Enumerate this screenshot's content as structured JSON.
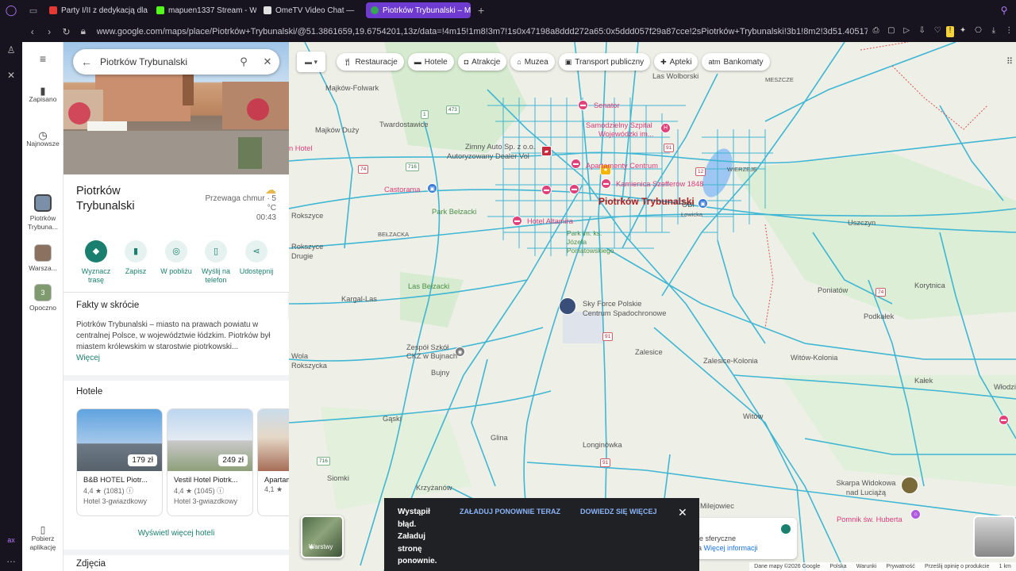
{
  "browser": {
    "tabs": [
      {
        "title": "Party I/II z dedykacją dla K",
        "color": "#e53935"
      },
      {
        "title": "mapuen1337 Stream - Wa",
        "color": "#53fc18"
      },
      {
        "title": "OmeTV Video Chat —",
        "color": "#e0e0e0"
      },
      {
        "title": "Piotrków Trybunalski – Ma",
        "color": "#34a853"
      }
    ],
    "url": "www.google.com/maps/place/Piotrków+Trybunalski/@51.3861659,19.6754201,13z/data=!4m15!1m8!3m7!1s0x47198a8ddd272a65:0x5ddd057f29a87cce!2sPiotrków+Trybunalski!3b1!8m2!3d51.4051721!4d19.7030244!16zL20vMDIyOH"
  },
  "rail": {
    "saved": "Zapisano",
    "recent": "Najnowsze",
    "place1": "Piotrków Trybuna...",
    "place2": "Warsza...",
    "place3": "Opoczno",
    "place3_badge": "3",
    "get_app": "Pobierz aplikację"
  },
  "panel": {
    "search_value": "Piotrków Trybunalski",
    "title": "Piotrków Trybunalski",
    "weather_desc": "Przewaga chmur · 5 °C",
    "time": "00:43",
    "actions": {
      "route": "Wyznacz trasę",
      "save": "Zapisz",
      "nearby": "W pobliżu",
      "send": "Wyślij na telefon",
      "share": "Udostępnij"
    },
    "facts_heading": "Fakty w skrócie",
    "facts_text": "Piotrków Trybunalski – miasto na prawach powiatu w centralnej Polsce, w województwie łódzkim. Piotrków był miastem królewskim w starostwie piotrkowski...",
    "more_link": "Więcej",
    "hotels_heading": "Hotele",
    "hotels": [
      {
        "name": "B&B HOTEL Piotr...",
        "price": "179 zł",
        "rating": "4,4 ★ (1081) ⓘ",
        "class": "Hotel 3-gwiazdkowy"
      },
      {
        "name": "Vestil Hotel Piotrk...",
        "price": "249 zł",
        "rating": "4,4 ★ (1045) ⓘ",
        "class": "Hotel 3-gwiazdkowy"
      },
      {
        "name": "Apartam...",
        "price": "",
        "rating": "4,1 ★",
        "class": ""
      }
    ],
    "show_more_hotels": "Wyświetl więcej hoteli",
    "photos_heading": "Zdjęcia"
  },
  "map": {
    "chips": [
      {
        "label": "Restauracje",
        "icon": "fork-knife"
      },
      {
        "label": "Hotele",
        "icon": "bed"
      },
      {
        "label": "Atrakcje",
        "icon": "camera"
      },
      {
        "label": "Muzea",
        "icon": "museum"
      },
      {
        "label": "Transport publiczny",
        "icon": "bus"
      },
      {
        "label": "Apteki",
        "icon": "pharmacy"
      },
      {
        "label": "Bankomaty",
        "icon": "atm"
      }
    ],
    "labels": {
      "las_wolborski": "Las Wolborski",
      "meszcze": "MESZCZE",
      "majkow_folwark": "Majków-Folwark",
      "twardostawice": "Twardostawice",
      "majkow_duzy": "Majków Duży",
      "zimny": "Zimny Auto Sp. z o.o.",
      "autoryzowany": "Autoryzowany Dealer Vol",
      "senator": "Senator",
      "szpital1": "Samodzielny Szpital",
      "szpital2": "Wojewódzki im...",
      "apartamenty": "Apartamenty Centrum",
      "kamienica": "Kamienica Szefferów 1848",
      "wierzeje": "WIERZEJE",
      "castorama": "Castorama",
      "park_belzacki": "Park Bełzacki",
      "city": "Piotrków Trybunalski",
      "obi": "OBI",
      "lowicka": "Łowicka",
      "rokszyce": "Rokszyce",
      "belzacka": "BEŁZACKA",
      "hotel_altamira": "Hotel Altamira",
      "park_jozefa": "Park im. ks. Józefa Poniatowskiego",
      "rokszyce_drugie": "Rokszyce Drugie",
      "uszczyn": "Uszczyn",
      "las_belzacki": "Las Bełzacki",
      "korytnica": "Korytnica",
      "kargal_las": "Kargal-Las",
      "sky_force": "Sky Force Polskie Centrum Spadochronowe",
      "poniatow": "Poniatów",
      "podkalek": "Podkałek",
      "wola_rokszycka": "Wola Rokszycka",
      "zespol": "Zespół Szkół CKZ w Bujnach",
      "zalesice": "Zalesice",
      "zalesice_kolonia": "Zalesice-Kolonia",
      "witow_kolonia": "Witów-Kolonia",
      "bujny": "Bujny",
      "kalek": "Kałek",
      "wlodzimierzow": "Włodzimierzów",
      "gaski": "Gąski",
      "witow": "Witów",
      "glina": "Glina",
      "longinowka": "Longinówka",
      "siomki": "Siomki",
      "krzyzanow": "Krzyżanów",
      "skarpa": "Skarpa Widokowa nad Luciążą",
      "milejowiec": "Milejowiec",
      "pomnik": "Pomnik św. Huberta",
      "hotel_left": "n Hotel"
    },
    "routes": {
      "r473": "473",
      "r1": "1",
      "r91": "91",
      "r74": "74",
      "r12": "12",
      "r716": "716",
      "r3": "3",
      "r716b": "716"
    },
    "layers_label": "Warstwy",
    "toast": {
      "message": "Wystąpił błąd. Załaduj stronę ponownie.",
      "reload": "ZAŁADUJ PONOWNIE TERAZ",
      "learn_more": "DOWIEDZ SIĘ WIĘCEJ"
    },
    "infobox": {
      "line1": "ie sferyczne",
      "line2": "a",
      "link": "Więcej informacji"
    },
    "attribution": {
      "data": "Dane mapy ©2026 Google",
      "country": "Polska",
      "terms": "Warunki",
      "privacy": "Prywatność",
      "feedback": "Prześlij opinię o produkcie",
      "scale": "1 km"
    },
    "road_color": "#3fb6d3",
    "park_color": "#cfe8c9"
  }
}
